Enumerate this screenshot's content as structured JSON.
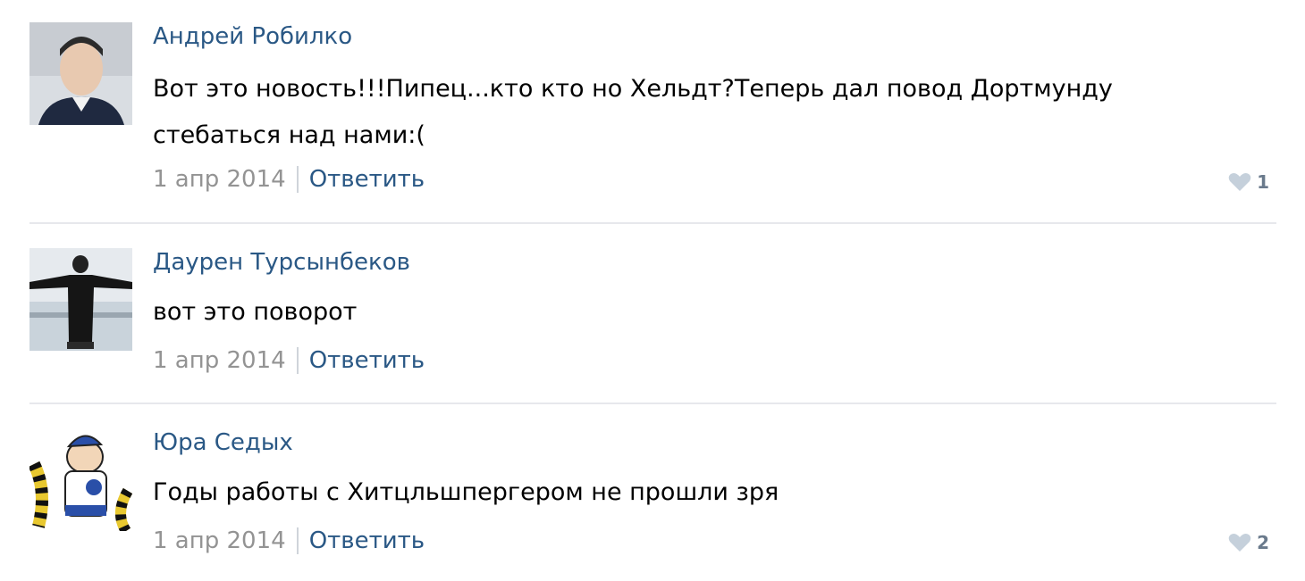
{
  "comments": [
    {
      "author": "Андрей Робилко",
      "text_lines": [
        "Вот это новость!!!Пипец...кто кто но Хельдт?Теперь дал повод Дортмунду",
        "стебаться над нами:("
      ],
      "date": "1 апр 2014",
      "reply_label": "Ответить",
      "likes": "1",
      "avatar_icon": "user-photo-avatar"
    },
    {
      "author": "Даурен Турсынбеков",
      "text_lines": [
        "вот это поворот"
      ],
      "date": "1 апр 2014",
      "reply_label": "Ответить",
      "likes": "",
      "avatar_icon": "user-photo-avatar"
    },
    {
      "author": "Юра Седых",
      "text_lines": [
        "Годы работы с Хитцльшпергером не прошли зря"
      ],
      "date": "1 апр 2014",
      "reply_label": "Ответить",
      "likes": "2",
      "avatar_icon": "cartoon-mascot-avatar"
    }
  ],
  "colors": {
    "author_link": "#2a5885",
    "date": "#939393",
    "divider": "#e7e8ec",
    "heart": "#c5d0db"
  }
}
